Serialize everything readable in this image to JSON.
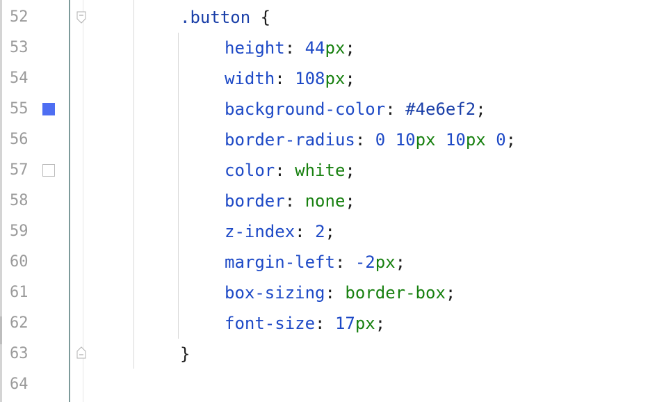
{
  "colors": {
    "swatch_blue": "#4e6ef2",
    "swatch_white": "#ffffff",
    "property": "#1d49c6",
    "keyword_value": "#17800f",
    "line_number": "#9a9a9a"
  },
  "lines": [
    {
      "num": "52",
      "selector": ".button",
      "open_brace": "{"
    },
    {
      "num": "53",
      "prop": "height",
      "num_value": "44",
      "unit": "px"
    },
    {
      "num": "54",
      "prop": "width",
      "num_value": "108",
      "unit": "px"
    },
    {
      "num": "55",
      "prop": "background-color",
      "hex_value": "#4e6ef2"
    },
    {
      "num": "56",
      "prop": "border-radius",
      "v1": "0",
      "v2": "10",
      "u2": "px",
      "v3": "10",
      "u3": "px",
      "v4": "0"
    },
    {
      "num": "57",
      "prop": "color",
      "kw_value": "white"
    },
    {
      "num": "58",
      "prop": "border",
      "kw_value": "none"
    },
    {
      "num": "59",
      "prop": "z-index",
      "num_value": "2"
    },
    {
      "num": "60",
      "prop": "margin-left",
      "num_value": "-2",
      "unit": "px"
    },
    {
      "num": "61",
      "prop": "box-sizing",
      "kw_value": "border-box"
    },
    {
      "num": "62",
      "prop": "font-size",
      "num_value": "17",
      "unit": "px"
    },
    {
      "num": "63",
      "close_brace": "}"
    },
    {
      "num": "64"
    }
  ],
  "punct": {
    "colon": ": ",
    "semicolon": ";",
    "space": " "
  }
}
